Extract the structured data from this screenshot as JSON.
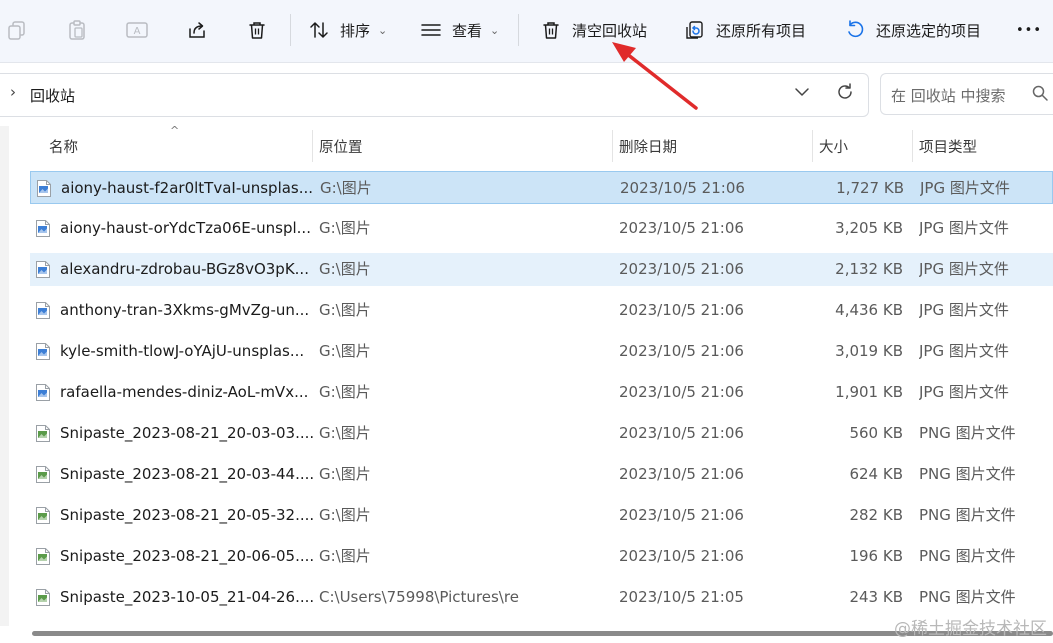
{
  "toolbar": {
    "sort_label": "排序",
    "view_label": "查看",
    "empty_bin_label": "清空回收站",
    "restore_all_label": "还原所有项目",
    "restore_selected_label": "还原选定的项目",
    "more_label": "•••"
  },
  "address": {
    "crumb": "回收站",
    "search_placeholder": "在 回收站 中搜索"
  },
  "columns": {
    "name": "名称",
    "location": "原位置",
    "deleted": "删除日期",
    "size": "大小",
    "type": "项目类型"
  },
  "files": [
    {
      "name": "aiony-haust-f2ar0ltTvaI-unsplas...",
      "location": "G:\\图片",
      "deleted": "2023/10/5 21:06",
      "size": "1,727 KB",
      "type": "JPG 图片文件",
      "kind": "jpg"
    },
    {
      "name": "aiony-haust-orYdcTza06E-unspl...",
      "location": "G:\\图片",
      "deleted": "2023/10/5 21:06",
      "size": "3,205 KB",
      "type": "JPG 图片文件",
      "kind": "jpg"
    },
    {
      "name": "alexandru-zdrobau-BGz8vO3pK...",
      "location": "G:\\图片",
      "deleted": "2023/10/5 21:06",
      "size": "2,132 KB",
      "type": "JPG 图片文件",
      "kind": "jpg"
    },
    {
      "name": "anthony-tran-3Xkms-gMvZg-un...",
      "location": "G:\\图片",
      "deleted": "2023/10/5 21:06",
      "size": "4,436 KB",
      "type": "JPG 图片文件",
      "kind": "jpg"
    },
    {
      "name": "kyle-smith-tlowJ-oYAjU-unsplas...",
      "location": "G:\\图片",
      "deleted": "2023/10/5 21:06",
      "size": "3,019 KB",
      "type": "JPG 图片文件",
      "kind": "jpg"
    },
    {
      "name": "rafaella-mendes-diniz-AoL-mVx...",
      "location": "G:\\图片",
      "deleted": "2023/10/5 21:06",
      "size": "1,901 KB",
      "type": "JPG 图片文件",
      "kind": "jpg"
    },
    {
      "name": "Snipaste_2023-08-21_20-03-03....",
      "location": "G:\\图片",
      "deleted": "2023/10/5 21:06",
      "size": "560 KB",
      "type": "PNG 图片文件",
      "kind": "png"
    },
    {
      "name": "Snipaste_2023-08-21_20-03-44....",
      "location": "G:\\图片",
      "deleted": "2023/10/5 21:06",
      "size": "624 KB",
      "type": "PNG 图片文件",
      "kind": "png"
    },
    {
      "name": "Snipaste_2023-08-21_20-05-32....",
      "location": "G:\\图片",
      "deleted": "2023/10/5 21:06",
      "size": "282 KB",
      "type": "PNG 图片文件",
      "kind": "png"
    },
    {
      "name": "Snipaste_2023-08-21_20-06-05....",
      "location": "G:\\图片",
      "deleted": "2023/10/5 21:06",
      "size": "196 KB",
      "type": "PNG 图片文件",
      "kind": "png"
    },
    {
      "name": "Snipaste_2023-10-05_21-04-26....",
      "location": "C:\\Users\\75998\\Pictures\\re",
      "deleted": "2023/10/5 21:05",
      "size": "243 KB",
      "type": "PNG 图片文件",
      "kind": "png"
    }
  ],
  "selected_row": 0,
  "hover_row": 2,
  "watermark": "@稀土掘金技术社区",
  "colors": {
    "accent": "#1a73e8",
    "arrow": "#e02b2b",
    "selection": "#cce4f7"
  }
}
